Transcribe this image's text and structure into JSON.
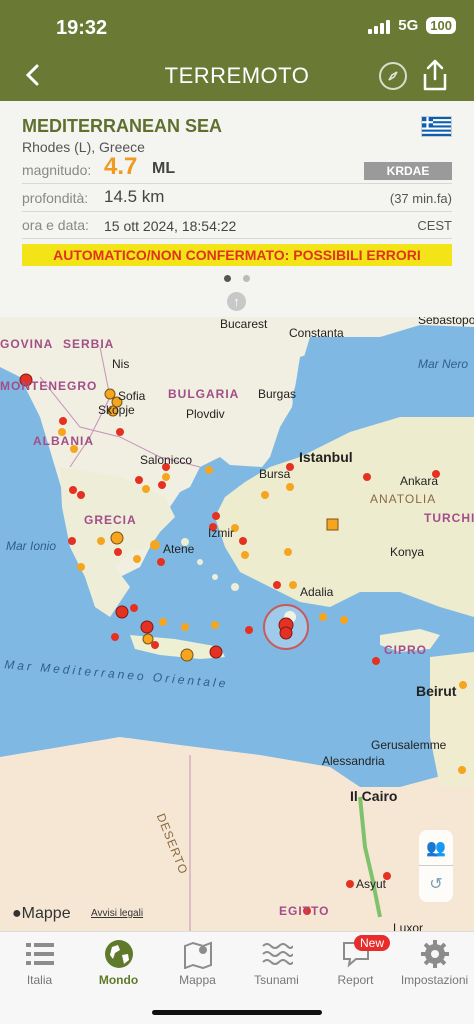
{
  "status": {
    "time": "19:32",
    "network": "5G",
    "battery": "100"
  },
  "header": {
    "title": "TERREMOTO",
    "back_icon": "chevron-left-icon",
    "compass_icon": "compass-icon",
    "share_icon": "share-icon"
  },
  "event": {
    "region": "MEDITERRANEAN SEA",
    "locality": "Rhodes (L), Greece",
    "magnitude_label": "magnitudo:",
    "magnitude_value": "4.7",
    "magnitude_unit": "ML",
    "agency": "KRDAE",
    "depth_label": "profondità:",
    "depth_value": "14.5 km",
    "ago": "(37 min.fa)",
    "time_label": "ora e data:",
    "time_value": "15 ott 2024, 18:54:22",
    "timezone": "CEST",
    "warning": "AUTOMATICO/NON CONFERMATO: POSSIBILI ERRORI"
  },
  "map": {
    "attribution": "Mappe",
    "legal": "Avvisi legali",
    "cities": [
      "Bucarest",
      "Constanta",
      "Sebastopoli",
      "Nis",
      "Sofia",
      "Skopje",
      "Plovdiv",
      "Burgas",
      "Istanbul",
      "Bursa",
      "Ankara",
      "Salonicco",
      "Atene",
      "Izmir",
      "Konya",
      "Adalia",
      "Beirut",
      "Gerusalemme",
      "Alessandria",
      "Il Cairo",
      "Asyut",
      "Luxor"
    ],
    "countries": [
      "SERBIA",
      "BULGARIA",
      "MONTENEGRO",
      "ALBANIA",
      "GRECIA",
      "ANATOLIA",
      "TURCHIA",
      "CIPRO",
      "EGITTO",
      "DESERTO",
      "GOVINA"
    ],
    "seas": [
      "Mar Nero",
      "Mar Ionio",
      "Mar Mediterraneo Orientale"
    ]
  },
  "tabs": [
    {
      "label": "Italia",
      "icon": "list-icon"
    },
    {
      "label": "Mondo",
      "icon": "globe-icon"
    },
    {
      "label": "Mappa",
      "icon": "map-icon"
    },
    {
      "label": "Tsunami",
      "icon": "waves-icon"
    },
    {
      "label": "Report",
      "icon": "report-icon",
      "badge": "New"
    },
    {
      "label": "Impostazioni",
      "icon": "gear-icon"
    }
  ],
  "colors": {
    "header": "#6a7a35",
    "magnitude": "#f09a20",
    "warning_bg": "#f3e418",
    "warning_text": "#e0331c"
  }
}
